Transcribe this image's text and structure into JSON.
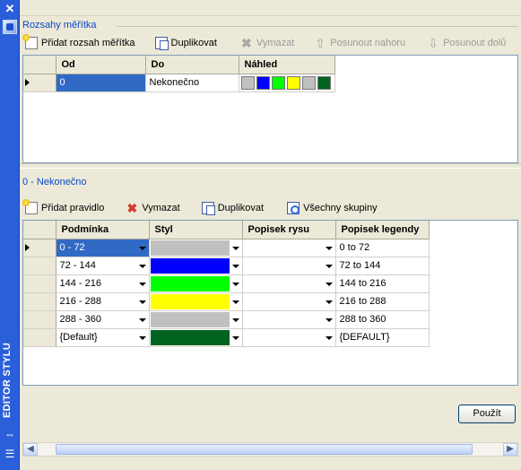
{
  "sidebar": {
    "title": "EDITOR STYLU",
    "close_icon": "close-icon",
    "app_icon": "layer-style-icon",
    "bottom_icons": [
      "collapse-arrows-icon",
      "list-icon"
    ]
  },
  "scale_ranges": {
    "section_title": "Rozsahy měřítka",
    "toolbar": {
      "add": "Přidat rozsah měřítka",
      "duplicate": "Duplikovat",
      "delete": "Vymazat",
      "move_up": "Posunout nahoru",
      "move_down": "Posunout dolů"
    },
    "columns": [
      "Od",
      "Do",
      "Náhled"
    ],
    "rows": [
      {
        "from": "0",
        "to": "Nekonečno",
        "preview_colors": [
          "#c0c0c0",
          "#0000ff",
          "#00ff00",
          "#ffff00",
          "#c0c0c0",
          "#006420"
        ]
      }
    ]
  },
  "rules": {
    "section_title": "0 - Nekonečno",
    "toolbar": {
      "add": "Přidat pravidlo",
      "delete": "Vymazat",
      "duplicate": "Duplikovat",
      "all_groups": "Všechny skupiny"
    },
    "columns": [
      "Podmínka",
      "Styl",
      "Popisek rysu",
      "Popisek legendy"
    ],
    "rows": [
      {
        "condition": "0 - 72",
        "style_color": "#c0c0c0",
        "feature_label": "",
        "legend_label": "0 to 72"
      },
      {
        "condition": "72 - 144",
        "style_color": "#0000ff",
        "feature_label": "",
        "legend_label": "72 to 144"
      },
      {
        "condition": "144 - 216",
        "style_color": "#00ff00",
        "feature_label": "",
        "legend_label": "144 to 216"
      },
      {
        "condition": "216 - 288",
        "style_color": "#ffff00",
        "feature_label": "",
        "legend_label": "216 to 288"
      },
      {
        "condition": "288 - 360",
        "style_color": "#c0c0c0",
        "feature_label": "",
        "legend_label": "288 to 360"
      },
      {
        "condition": "{Default}",
        "style_color": "#006420",
        "feature_label": "",
        "legend_label": "{DEFAULT}"
      }
    ]
  },
  "apply_button": "Použít",
  "colors": {
    "sidebar": "#2b5fd9",
    "selection": "#316ac5",
    "section_title": "#0a48c8"
  }
}
